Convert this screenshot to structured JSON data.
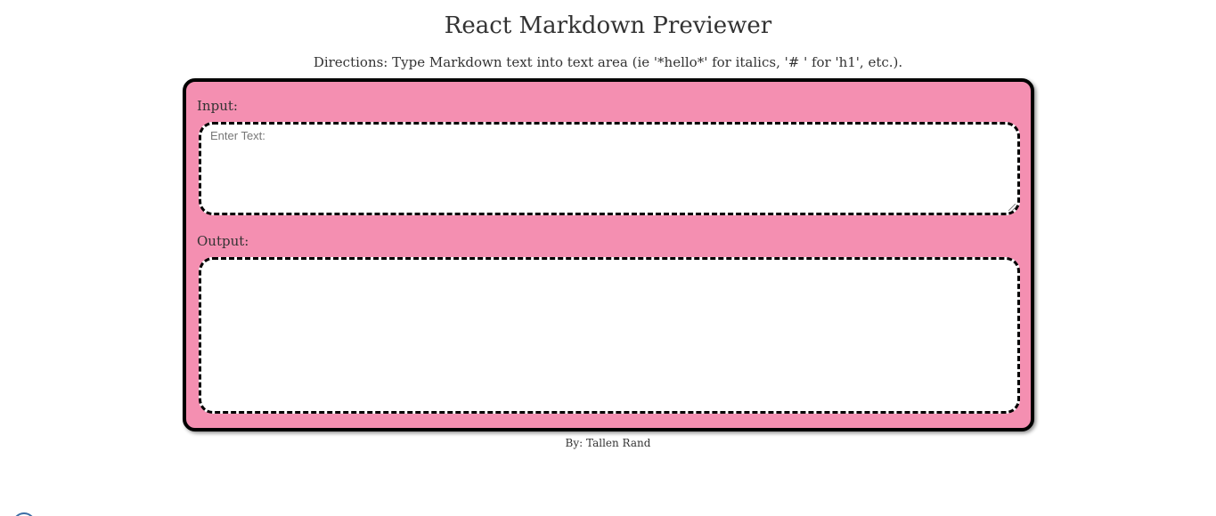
{
  "header": {
    "title": "React Markdown Previewer",
    "directions": "Directions: Type Markdown text into text area (ie '*hello*' for italics, '# ' for 'h1', etc.)."
  },
  "editor": {
    "input_label": "Input:",
    "input_placeholder": "Enter Text:",
    "input_value": "",
    "output_label": "Output:",
    "output_value": ""
  },
  "footer": {
    "byline": "By: Tallen Rand"
  },
  "colors": {
    "panel_background": "#f48fb1",
    "panel_border": "#000000",
    "text": "#333333"
  }
}
